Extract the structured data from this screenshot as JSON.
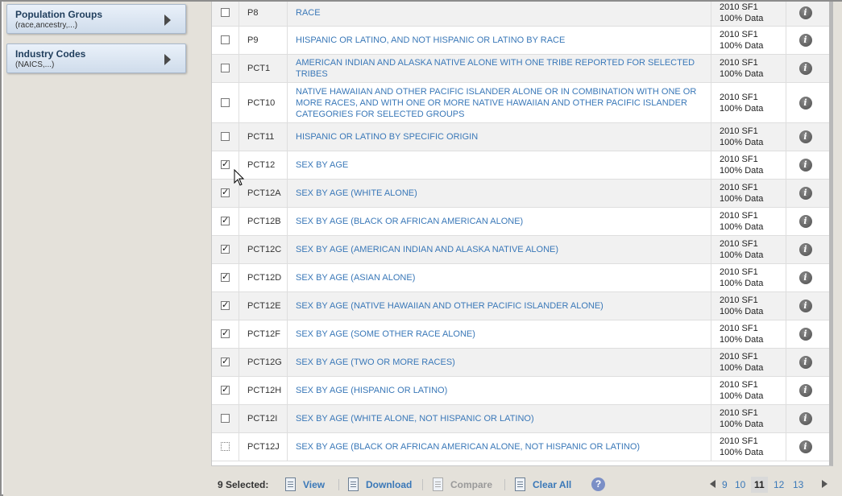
{
  "sidebar": {
    "panels": [
      {
        "title": "Population Groups",
        "subtitle": "(race,ancestry,...)"
      },
      {
        "title": "Industry Codes",
        "subtitle": "(NAICS,...)"
      }
    ]
  },
  "table": {
    "dataset_line1": "2010 SF1",
    "dataset_line2": "100% Data",
    "rows": [
      {
        "id": "P8",
        "title": "RACE",
        "checked": false
      },
      {
        "id": "P9",
        "title": "HISPANIC OR LATINO, AND NOT HISPANIC OR LATINO BY RACE",
        "checked": false
      },
      {
        "id": "PCT1",
        "title": "AMERICAN INDIAN AND ALASKA NATIVE ALONE WITH ONE TRIBE REPORTED FOR SELECTED TRIBES",
        "checked": false
      },
      {
        "id": "PCT10",
        "title": "NATIVE HAWAIIAN AND OTHER PACIFIC ISLANDER ALONE OR IN COMBINATION WITH ONE OR MORE RACES, AND WITH ONE OR MORE NATIVE HAWAIIAN AND OTHER PACIFIC ISLANDER CATEGORIES FOR SELECTED GROUPS",
        "checked": false
      },
      {
        "id": "PCT11",
        "title": "HISPANIC OR LATINO BY SPECIFIC ORIGIN",
        "checked": false
      },
      {
        "id": "PCT12",
        "title": "SEX BY AGE",
        "checked": true
      },
      {
        "id": "PCT12A",
        "title": "SEX BY AGE (WHITE ALONE)",
        "checked": true
      },
      {
        "id": "PCT12B",
        "title": "SEX BY AGE (BLACK OR AFRICAN AMERICAN ALONE)",
        "checked": true
      },
      {
        "id": "PCT12C",
        "title": "SEX BY AGE (AMERICAN INDIAN AND ALASKA NATIVE ALONE)",
        "checked": true
      },
      {
        "id": "PCT12D",
        "title": "SEX BY AGE (ASIAN ALONE)",
        "checked": true
      },
      {
        "id": "PCT12E",
        "title": "SEX BY AGE (NATIVE HAWAIIAN AND OTHER PACIFIC ISLANDER ALONE)",
        "checked": true
      },
      {
        "id": "PCT12F",
        "title": "SEX BY AGE (SOME OTHER RACE ALONE)",
        "checked": true
      },
      {
        "id": "PCT12G",
        "title": "SEX BY AGE (TWO OR MORE RACES)",
        "checked": true
      },
      {
        "id": "PCT12H",
        "title": "SEX BY AGE (HISPANIC OR LATINO)",
        "checked": true
      },
      {
        "id": "PCT12I",
        "title": "SEX BY AGE (WHITE ALONE, NOT HISPANIC OR LATINO)",
        "checked": false
      },
      {
        "id": "PCT12J",
        "title": "SEX BY AGE (BLACK OR AFRICAN AMERICAN ALONE, NOT HISPANIC OR LATINO)",
        "checked": false,
        "focused": true
      }
    ]
  },
  "footer": {
    "selected_label": "9 Selected:",
    "view_label": "View",
    "download_label": "Download",
    "compare_label": "Compare",
    "clear_label": "Clear All",
    "help_glyph": "?",
    "pages": [
      "9",
      "10",
      "11",
      "12",
      "13"
    ],
    "current_page": "11"
  },
  "icons": {
    "info": "info-icon",
    "help": "help-icon",
    "checkmark": "✓",
    "info_glyph": "i"
  }
}
